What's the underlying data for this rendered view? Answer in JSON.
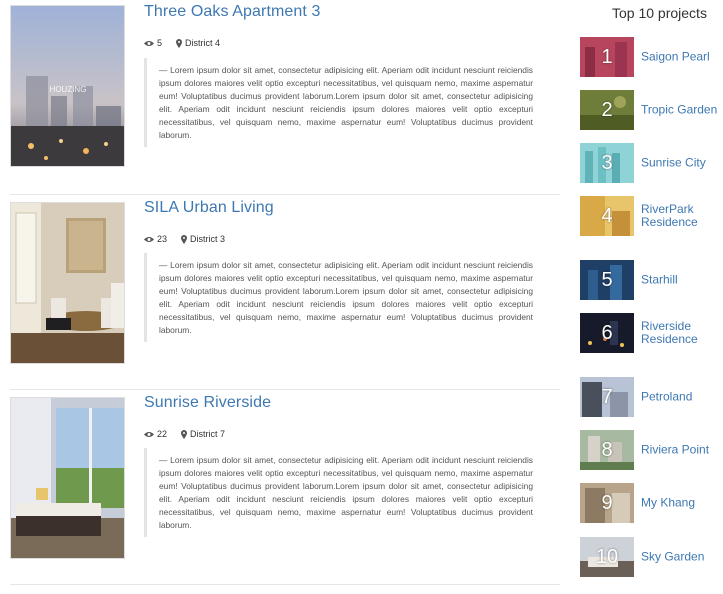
{
  "projects": [
    {
      "title": "Three Oaks Apartment 3",
      "views": "5",
      "district": "District 4",
      "watermark": "HOUZING",
      "description": "— Lorem ipsum dolor sit amet, consectetur adipisicing elit. Aperiam odit incidunt nesciunt reiciendis ipsum dolores maiores velit optio excepturi necessitatibus, vel quisquam nemo, maxime aspernatur eum! Voluptatibus ducimus provident laborum.Lorem ipsum dolor sit amet, consectetur adipisicing elit. Aperiam odit incidunt nesciunt reiciendis ipsum dolores maiores velit optio excepturi necessitatibus, vel quisquam nemo, maxime aspernatur eum! Voluptatibus ducimus provident laborum."
    },
    {
      "title": "SILA Urban Living",
      "views": "23",
      "district": "District 3",
      "description": "— Lorem ipsum dolor sit amet, consectetur adipisicing elit. Aperiam odit incidunt nesciunt reiciendis ipsum dolores maiores velit optio excepturi necessitatibus, vel quisquam nemo, maxime aspernatur eum! Voluptatibus ducimus provident laborum.Lorem ipsum dolor sit amet, consectetur adipisicing elit. Aperiam odit incidunt nesciunt reiciendis ipsum dolores maiores velit optio excepturi necessitatibus, vel quisquam nemo, maxime aspernatur eum! Voluptatibus ducimus provident laborum."
    },
    {
      "title": "Sunrise Riverside",
      "views": "22",
      "district": "District 7",
      "description": "— Lorem ipsum dolor sit amet, consectetur adipisicing elit. Aperiam odit incidunt nesciunt reiciendis ipsum dolores maiores velit optio excepturi necessitatibus, vel quisquam nemo, maxime aspernatur eum! Voluptatibus ducimus provident laborum.Lorem ipsum dolor sit amet, consectetur adipisicing elit. Aperiam odit incidunt nesciunt reiciendis ipsum dolores maiores velit optio excepturi necessitatibus, vel quisquam nemo, maxime aspernatur eum! Voluptatibus ducimus provident laborum."
    }
  ],
  "icons": {
    "views": "eye-icon",
    "location": "map-pin-icon"
  },
  "colors": {
    "link": "#3e78b2",
    "quote_border": "#e4e4e4",
    "divider": "#e6e6e6"
  },
  "sidebar": {
    "title": "Top 10 projects",
    "items": [
      {
        "rank": "1",
        "name": "Saigon Pearl"
      },
      {
        "rank": "2",
        "name": "Tropic Garden"
      },
      {
        "rank": "3",
        "name": "Sunrise City"
      },
      {
        "rank": "4",
        "name": "RiverPark Residence"
      },
      {
        "rank": "5",
        "name": "Starhill"
      },
      {
        "rank": "6",
        "name": "Riverside Residence"
      },
      {
        "rank": "7",
        "name": "Petroland"
      },
      {
        "rank": "8",
        "name": "Riviera Point"
      },
      {
        "rank": "9",
        "name": "My Khang"
      },
      {
        "rank": "10",
        "name": "Sky Garden"
      }
    ]
  }
}
